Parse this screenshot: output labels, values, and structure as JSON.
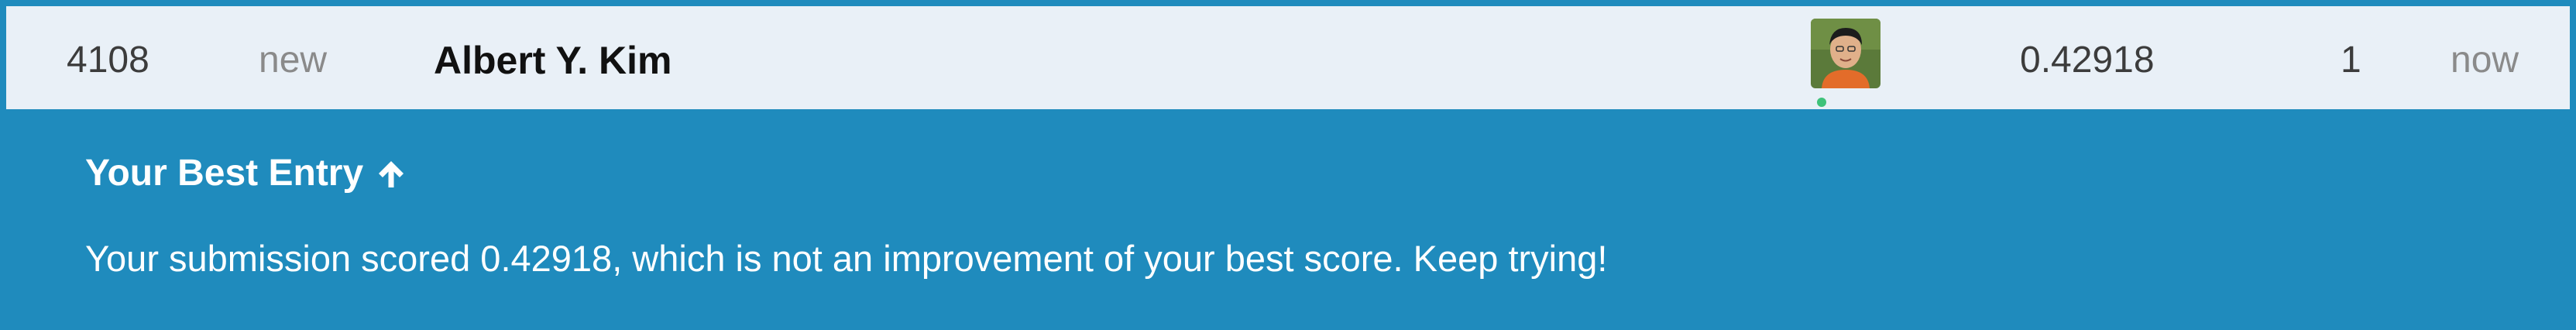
{
  "leaderboard_row": {
    "rank": "4108",
    "change": "new",
    "team_name": "Albert Y. Kim",
    "score": "0.42918",
    "entries": "1",
    "last": "now",
    "avatar_icon": "user-avatar-photo",
    "online_status_color": "#3ec27a"
  },
  "banner": {
    "title": "Your Best Entry",
    "title_icon": "arrow-up-icon",
    "message": "Your submission scored 0.42918, which is not an improvement of your best score. Keep trying!",
    "background_color": "#1f8bbd",
    "row_background_color": "#e9f0f7"
  }
}
